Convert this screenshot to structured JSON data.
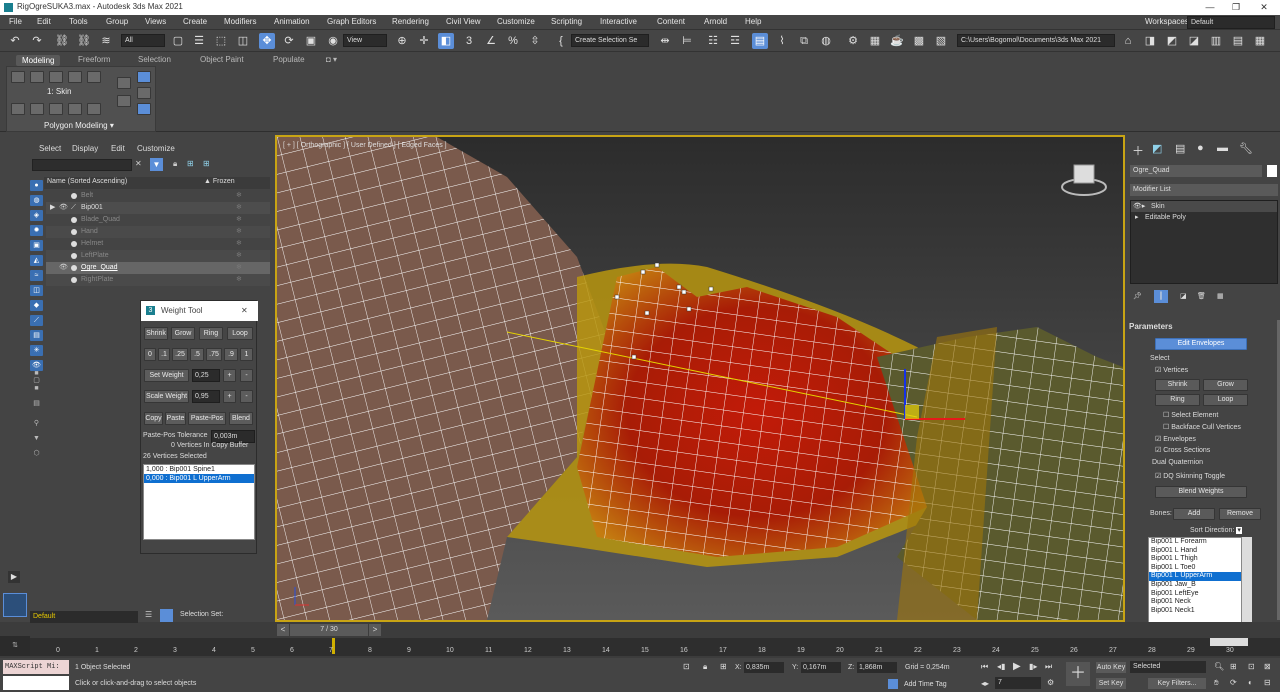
{
  "app": {
    "title": "RigOgreSUKA3.max - Autodesk 3ds Max 2021",
    "workspace_label": "Workspaces:",
    "workspace_value": "Default"
  },
  "menu": [
    "File",
    "Edit",
    "Tools",
    "Group",
    "Views",
    "Create",
    "Modifiers",
    "Animation",
    "Graph Editors",
    "Rendering",
    "Civil View",
    "Customize",
    "Scripting",
    "Interactive",
    "Content",
    "Arnold",
    "Help"
  ],
  "toolbar": {
    "filter": "All",
    "view": "View",
    "selection_set": "Create Selection Se",
    "project_path": "C:\\Users\\Bogomol\\Documents\\3ds Max 2021"
  },
  "ribbon": {
    "tabs": [
      "Modeling",
      "Freeform",
      "Selection",
      "Object Paint",
      "Populate"
    ],
    "modifier_label": "1: Skin",
    "panel_title": "Polygon Modeling ▾"
  },
  "scene": {
    "tabs": [
      "Select",
      "Display",
      "Edit",
      "Customize"
    ],
    "col_name": "Name (Sorted Ascending)",
    "col_frozen": "▲ Frozen",
    "rows": [
      {
        "name": "Belt",
        "sel": false,
        "eye": false
      },
      {
        "name": "Bip001",
        "sel": false,
        "eye": true
      },
      {
        "name": "Blade_Quad",
        "sel": false,
        "eye": false
      },
      {
        "name": "Hand",
        "sel": false,
        "eye": false
      },
      {
        "name": "Helmet",
        "sel": false,
        "eye": false
      },
      {
        "name": "LeftPlate",
        "sel": false,
        "eye": false
      },
      {
        "name": "Ogre_Quad",
        "sel": true,
        "eye": true
      },
      {
        "name": "RightPlate",
        "sel": false,
        "eye": false
      }
    ]
  },
  "weight_tool": {
    "title": "Weight Tool",
    "row1": [
      "Shrink",
      "Grow",
      "Ring",
      "Loop"
    ],
    "presets": [
      "0",
      ".1",
      ".25",
      ".5",
      ".75",
      ".9",
      "1"
    ],
    "set_weight_label": "Set Weight",
    "set_weight_value": "0,25",
    "scale_weight_label": "Scale Weight",
    "scale_weight_value": "0,95",
    "row4": [
      "Copy",
      "Paste",
      "Paste-Pos",
      "Blend"
    ],
    "tol_label": "Paste-Pos Tolerance",
    "tol_value": "0,003m",
    "buffer": "0 Vertices In Copy Buffer",
    "selected": "26 Vertices Selected",
    "list": [
      "1,000 : Bip001 Spine1",
      "0,000 : Bip001 L UpperArm"
    ]
  },
  "viewport": {
    "label": "[ + ] [ Orthographic ] [ User Defined ] [ Edged Faces ]"
  },
  "command_panel": {
    "object_name": "Ogre_Quad",
    "modifier_list_label": "Modifier List",
    "stack": [
      "Skin",
      "Editable Poly"
    ],
    "parameters_title": "Parameters",
    "edit_envelopes": "Edit Envelopes",
    "select_label": "Select",
    "vertices": "Vertices",
    "buttons": [
      "Shrink",
      "Grow",
      "Ring",
      "Loop"
    ],
    "select_element": "Select Element",
    "backface": "Backface Cull Vertices",
    "envelopes": "Envelopes",
    "cross_sections": "Cross Sections",
    "dq_label": "Dual Quaternion",
    "dq_toggle": "DQ Skinning Toggle",
    "blend_weights": "Blend Weights",
    "bones_label": "Bones:",
    "add": "Add",
    "remove": "Remove",
    "sort": "Sort Direction:",
    "bones": [
      "Bip001 L Forearm",
      "Bip001 L Hand",
      "Bip001 L Thigh",
      "Bip001 L Toe0",
      "Bip001 L UpperArm",
      "Bip001 Jaw_B",
      "Bip001 LeftEye",
      "Bip001 Neck",
      "Bip001 Neck1"
    ]
  },
  "timeline": {
    "frame": "7 / 30",
    "layer": "Default",
    "selection_set_label": "Selection Set:",
    "ticks": [
      "0",
      "1",
      "2",
      "3",
      "4",
      "5",
      "6",
      "7",
      "8",
      "9",
      "10",
      "11",
      "12",
      "13",
      "14",
      "15",
      "16",
      "17",
      "18",
      "19",
      "20",
      "21",
      "22",
      "23",
      "24",
      "25",
      "26",
      "27",
      "28",
      "29",
      "30"
    ]
  },
  "status": {
    "script": "MAXScript Mi:",
    "objects": "1 Object Selected",
    "hint": "Click or click-and-drag to select objects",
    "x_label": "X:",
    "x": "0,835m",
    "y_label": "Y:",
    "y": "0,167m",
    "z_label": "Z:",
    "z": "1,868m",
    "grid": "Grid = 0,254m",
    "add_time_tag": "Add Time Tag",
    "frame_field": "7",
    "auto_key": "Auto Key",
    "selected": "Selected",
    "set_key": "Set Key",
    "key_filters": "Key Filters..."
  }
}
